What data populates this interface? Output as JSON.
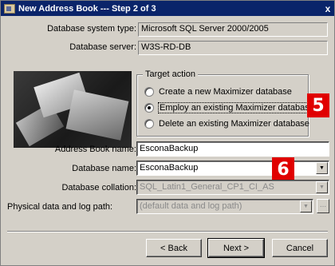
{
  "window": {
    "title": "New Address Book --- Step 2 of 3",
    "close_glyph": "x"
  },
  "fields": {
    "db_system_type_label": "Database system type:",
    "db_system_type_value": "Microsoft SQL Server 2000/2005",
    "db_server_label": "Database server:",
    "db_server_value": "W3S-RD-DB",
    "address_book_name_label": "Address Book name:",
    "address_book_name_value": "EsconaBackup",
    "database_name_label": "Database name:",
    "database_name_value": "EsconaBackup",
    "database_collation_label": "Database collation:",
    "database_collation_value": "SQL_Latin1_General_CP1_CI_AS",
    "physical_path_label": "Physical data and log path:",
    "physical_path_value": "(default data and log path)"
  },
  "target_action": {
    "legend": "Target action",
    "options": [
      {
        "label": "Create a new Maximizer database",
        "checked": false
      },
      {
        "label": "Employ an existing Maximizer database",
        "checked": true
      },
      {
        "label": "Delete an existing Maximizer database",
        "checked": false
      }
    ]
  },
  "callouts": {
    "five": "5",
    "six": "6"
  },
  "buttons": {
    "back": "< Back",
    "next": "Next >",
    "cancel": "Cancel",
    "browse": "..."
  },
  "colors": {
    "titlebar": "#0a246a",
    "callout": "#e00000",
    "dialog_face": "#d4d0c8"
  },
  "icons": [
    "app-icon",
    "close-icon",
    "dropdown-arrow-icon",
    "radio-icon"
  ]
}
